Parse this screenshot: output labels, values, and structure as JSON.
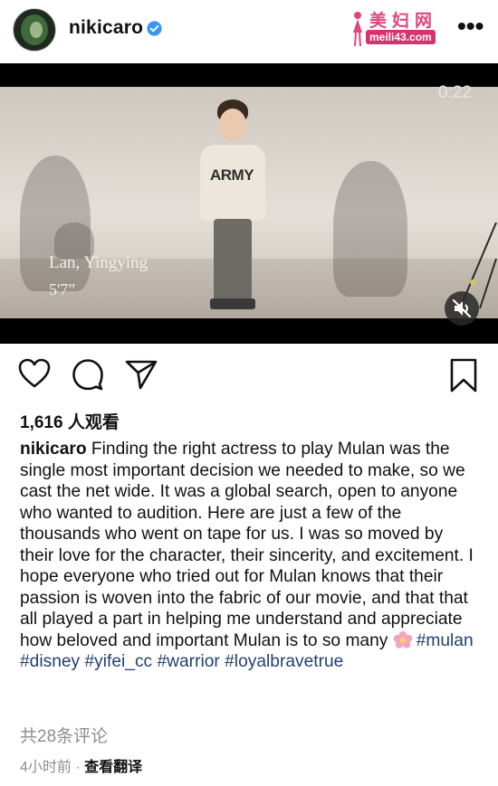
{
  "header": {
    "username": "nikicaro",
    "watermark_title": "美妇网",
    "watermark_url": "meili43.com"
  },
  "video": {
    "timer": "0:22",
    "caption_name": "Lan, Yingying",
    "caption_height": "5'7”",
    "sweater_text": "ARMY"
  },
  "post": {
    "views": "1,616 人观看",
    "caption_username": "nikicaro",
    "caption_text": " Finding the right actress to play Mulan was the single most important decision we needed to make, so we cast the net wide.  It was a global search, open to anyone who wanted to audition. Here are just a few of the thousands who went on tape for us.  I was so moved by their love  for the character, their sincerity, and excitement.  I hope everyone who tried out  for Mulan knows that their passion is woven into the fabric of our movie, and that that all played a part in helping me understand and appreciate how beloved and important Mulan is to so many ",
    "hashtags": [
      "#mulan",
      "#disney",
      "#yifei_cc",
      "#warrior",
      "#loyalbravetrue"
    ],
    "comments": "共28条评论",
    "time": "4小时前",
    "separator": "·",
    "translate": "查看翻译"
  },
  "colors": {
    "hashtag": "#23406f",
    "verified": "#3897f0",
    "meta": "#8e8e8e"
  },
  "icons": [
    "heart-icon",
    "comment-icon",
    "share-icon",
    "bookmark-icon",
    "more-icon",
    "mute-icon",
    "verified-icon",
    "flower-emoji"
  ]
}
